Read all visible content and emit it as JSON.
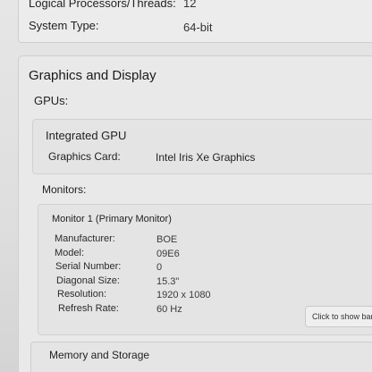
{
  "system": {
    "logical_processors_label": "Logical Processors/Threads:",
    "logical_processors_value": "12",
    "system_type_label": "System Type:",
    "system_type_value": "64-bit"
  },
  "graphics": {
    "title": "Graphics and Display",
    "gpus_label": "GPUs:",
    "integrated_title": "Integrated GPU",
    "graphics_card_label": "Graphics Card:",
    "graphics_card_value": "Intel Iris Xe Graphics",
    "monitors_label": "Monitors:",
    "monitor1": {
      "title": "Monitor 1 (Primary Monitor)",
      "rows": [
        {
          "label": "Manufacturer:",
          "value": "BOE"
        },
        {
          "label": "Model:",
          "value": "09E6"
        },
        {
          "label": "Serial Number:",
          "value": "0"
        },
        {
          "label": "Diagonal Size:",
          "value": "15.3\""
        },
        {
          "label": "Resolution:",
          "value": "1920 x 1080"
        },
        {
          "label": "Refresh Rate:",
          "value": "60 Hz"
        }
      ]
    }
  },
  "tooltip_button": "Click to show bar",
  "memory": {
    "title": "Memory and Storage"
  }
}
